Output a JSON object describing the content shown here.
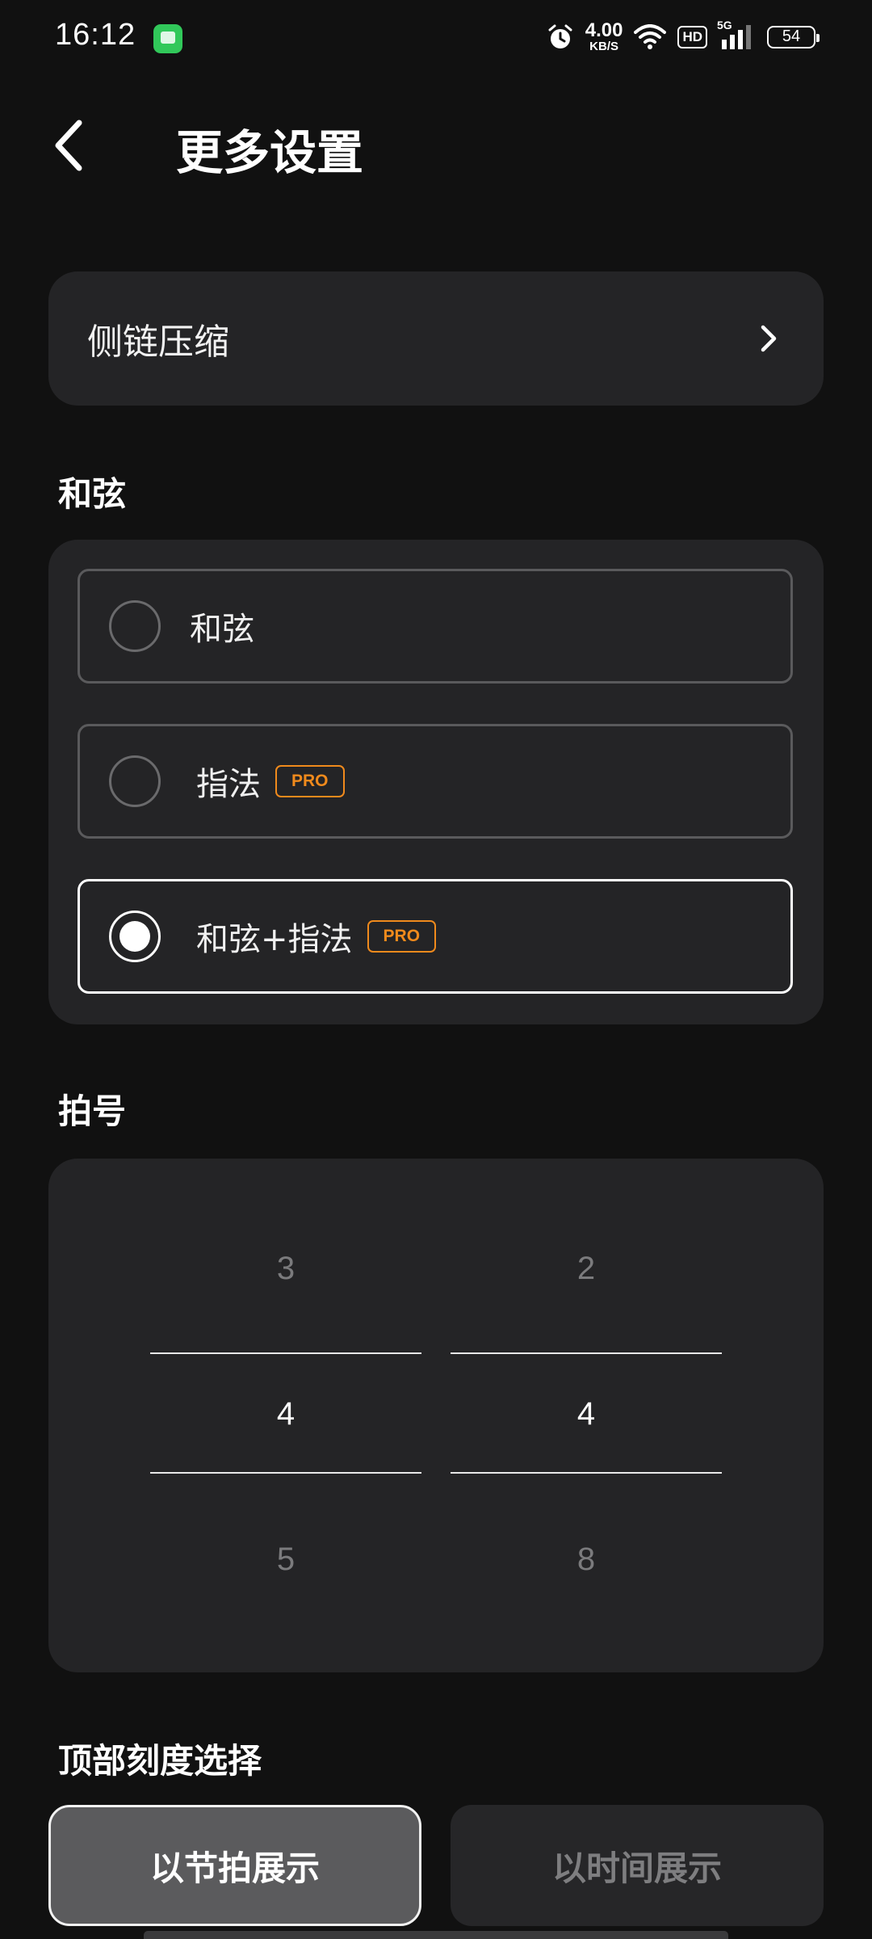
{
  "status_bar": {
    "time": "16:12",
    "net_speed_value": "4.00",
    "net_speed_unit": "KB/S",
    "hd": "HD",
    "network": "5G",
    "battery": "54",
    "icons": [
      "messages-app-icon",
      "alarm-icon",
      "wifi-icon",
      "signal-icon",
      "battery-icon"
    ]
  },
  "header": {
    "title": "更多设置"
  },
  "sidechain": {
    "label": "侧链压缩"
  },
  "chord_section": {
    "title": "和弦",
    "options": [
      {
        "label": "和弦",
        "pro": "",
        "selected": false
      },
      {
        "label": "指法",
        "pro": "PRO",
        "selected": false
      },
      {
        "label": "和弦+指法",
        "pro": "PRO",
        "selected": true
      }
    ]
  },
  "time_signature": {
    "title": "拍号",
    "numerator": {
      "above": "3",
      "selected": "4",
      "below": "5"
    },
    "denominator": {
      "above": "2",
      "selected": "4",
      "below": "8"
    }
  },
  "top_scale": {
    "title": "顶部刻度选择",
    "by_beat": "以节拍展示",
    "by_time": "以时间展示",
    "selected": "by_beat"
  },
  "colors": {
    "background": "#111111",
    "card": "#242426",
    "pro_accent": "#f08a1c"
  }
}
